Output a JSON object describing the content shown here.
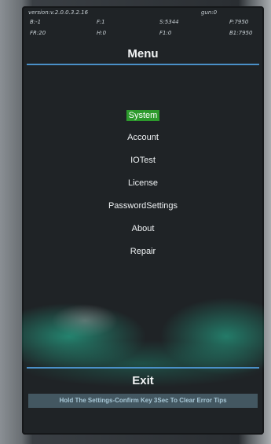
{
  "status": {
    "version": "version:v.2.0.0.3.2.16",
    "gun": "gun:0",
    "b": "B:-1",
    "f": "F:1",
    "s": "S:5344",
    "p": "P:7950",
    "fr": "FR:20",
    "h": "H:0",
    "f1": "F1:0",
    "b1": "B1:7950"
  },
  "title": "Menu",
  "menu": {
    "selected_index": 0,
    "items": [
      {
        "label": "System"
      },
      {
        "label": "Account"
      },
      {
        "label": "IOTest"
      },
      {
        "label": "License"
      },
      {
        "label": "PasswordSettings"
      },
      {
        "label": "About"
      },
      {
        "label": "Repair"
      }
    ]
  },
  "exit_label": "Exit",
  "tips": "Hold The Settings-Confirm Key 3Sec To Clear Error Tips",
  "colors": {
    "accent_line": "#4a90c8",
    "selected_bg": "#2c9a2c",
    "screen_bg": "#1f2326"
  }
}
